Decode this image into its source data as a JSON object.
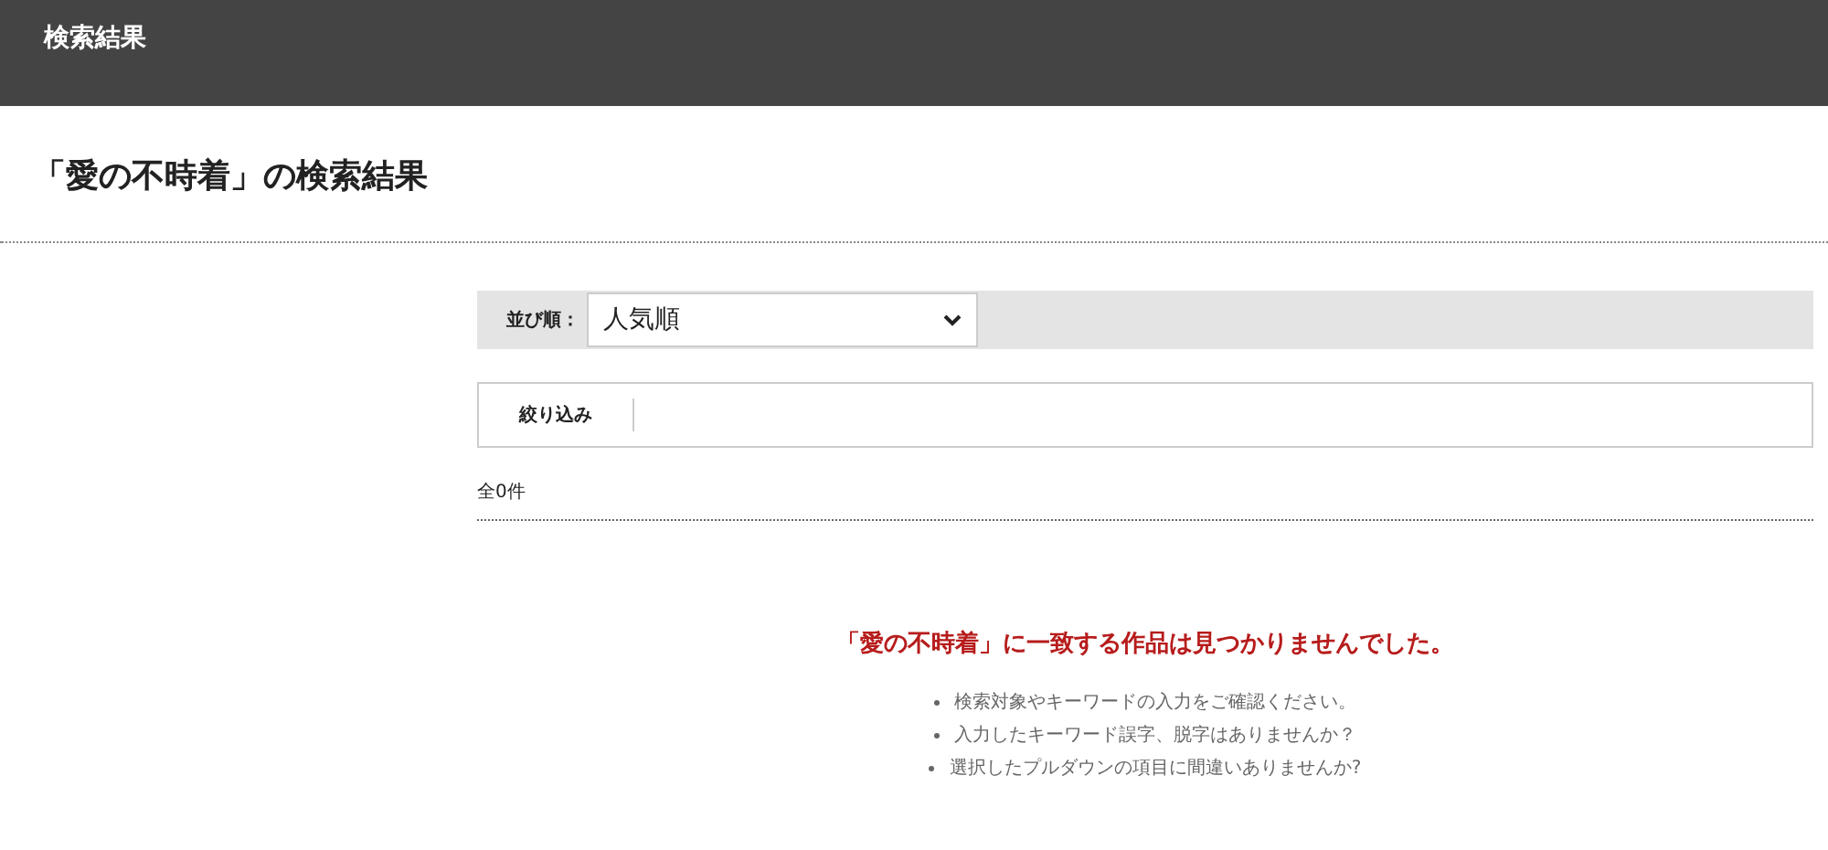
{
  "header": {
    "title": "検索結果"
  },
  "page_title": "「愛の不時着」の検索結果",
  "sort": {
    "label": "並び順：",
    "value": "人気順"
  },
  "filter": {
    "label": "絞り込み"
  },
  "count": "全0件",
  "message": "「愛の不時着」に一致する作品は見つかりませんでした。",
  "hints": [
    "検索対象やキーワードの入力をご確認ください。",
    "入力したキーワード誤字、脱字はありませんか？",
    "選択したプルダウンの項目に間違いありませんか?"
  ]
}
